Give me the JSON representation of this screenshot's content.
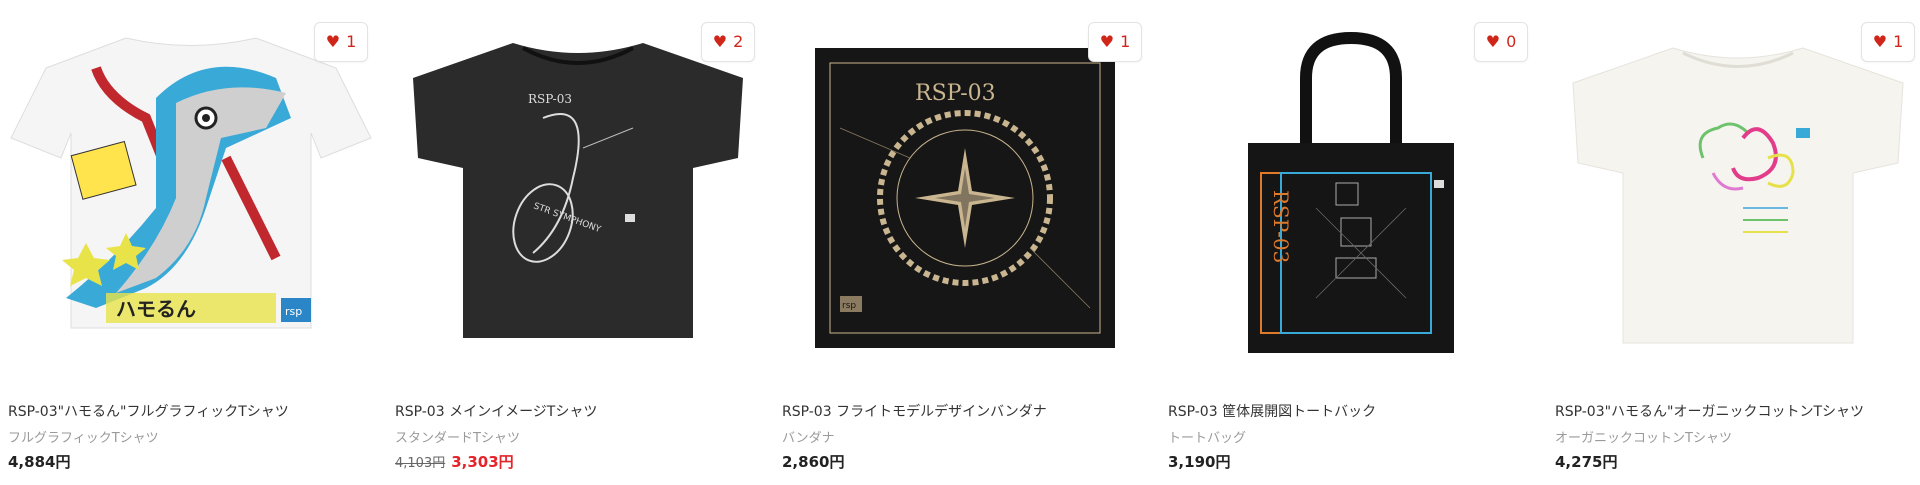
{
  "products": [
    {
      "title": "RSP-03\"ハモるん\"フルグラフィックTシャツ",
      "category": "フルグラフィックTシャツ",
      "price": "4,884円",
      "likes": "1",
      "image": "full-graphic-tshirt-hamorun"
    },
    {
      "title": "RSP-03 メインイメージTシャツ",
      "category": "スタンダードTシャツ",
      "price_original": "4,103円",
      "price_sale": "3,303円",
      "likes": "2",
      "image": "black-tshirt-main-image"
    },
    {
      "title": "RSP-03 フライトモデルデザインバンダナ",
      "category": "バンダナ",
      "price": "2,860円",
      "likes": "1",
      "image": "black-bandana-compass"
    },
    {
      "title": "RSP-03 筐体展開図トートバック",
      "category": "トートバッグ",
      "price": "3,190円",
      "likes": "0",
      "image": "black-tote-exploded-view"
    },
    {
      "title": "RSP-03\"ハモるん\"オーガニックコットンTシャツ",
      "category": "オーガニックコットンTシャツ",
      "price": "4,275円",
      "likes": "1",
      "image": "organic-cotton-tshirt"
    }
  ],
  "artwork_text": {
    "rsp_logo": "RSP-03",
    "rsp_badge": "rsp",
    "tote_vertical": "RSP-03",
    "symphony": "STR SYMPHONY",
    "hamorun_script": "ハモるん"
  },
  "colors": {
    "heart": "#d0261a",
    "sale": "#e3252b",
    "tshirt_black": "#2b2b2b",
    "bandana_black": "#161616",
    "gold": "#c9b58f",
    "blue": "#39a9d8",
    "orange": "#e07a2b"
  }
}
